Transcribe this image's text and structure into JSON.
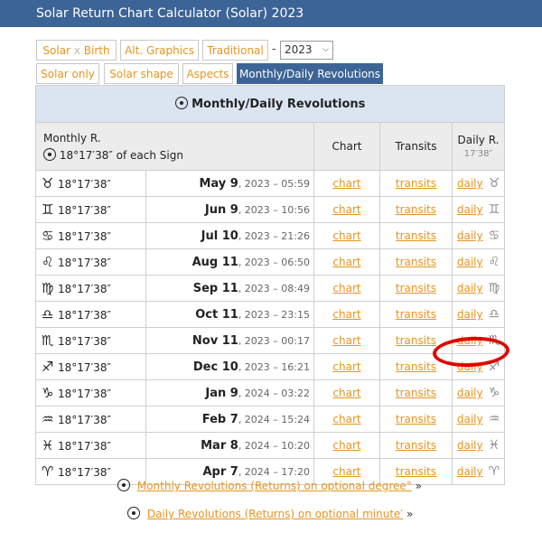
{
  "window": {
    "title": "Solar Return Chart Calculator (Solar) 2023"
  },
  "tabs_row1": [
    {
      "label": "Solar",
      "x": " x ",
      "label2": "Birth"
    },
    {
      "label": "Alt. Graphics"
    },
    {
      "label": "Traditional"
    }
  ],
  "year_select": {
    "separator": "-",
    "value": "2023"
  },
  "tabs_row2": [
    {
      "label": "Solar only"
    },
    {
      "label": "Solar shape"
    },
    {
      "label": "Aspects"
    },
    {
      "label": "Monthly/Daily Revolutions",
      "active": true
    }
  ],
  "table": {
    "caption": "Monthly/Daily Revolutions",
    "header": {
      "monthly_title": "Monthly R.",
      "monthly_sub": "18°17′38″ of each Sign",
      "chart": "Chart",
      "transits": "Transits",
      "daily_title": "Daily R.",
      "daily_sub": "17′38″"
    },
    "rows": [
      {
        "sign": "♉",
        "degree": "18°17′38″",
        "date": "May 9",
        "rest": ", 2023 – 05:59",
        "chart": "chart",
        "transits": "transits",
        "daily": "daily",
        "dsign": "♉"
      },
      {
        "sign": "♊",
        "degree": "18°17′38″",
        "date": "Jun 9",
        "rest": ", 2023 – 10:56",
        "chart": "chart",
        "transits": "transits",
        "daily": "daily",
        "dsign": "♊"
      },
      {
        "sign": "♋",
        "degree": "18°17′38″",
        "date": "Jul 10",
        "rest": ", 2023 – 21:26",
        "chart": "chart",
        "transits": "transits",
        "daily": "daily",
        "dsign": "♋"
      },
      {
        "sign": "♌",
        "degree": "18°17′38″",
        "date": "Aug 11",
        "rest": ", 2023 – 06:50",
        "chart": "chart",
        "transits": "transits",
        "daily": "daily",
        "dsign": "♌"
      },
      {
        "sign": "♍",
        "degree": "18°17′38″",
        "date": "Sep 11",
        "rest": ", 2023 – 08:49",
        "chart": "chart",
        "transits": "transits",
        "daily": "daily",
        "dsign": "♍"
      },
      {
        "sign": "♎",
        "degree": "18°17′38″",
        "date": "Oct 11",
        "rest": ", 2023 – 23:15",
        "chart": "chart",
        "transits": "transits",
        "daily": "daily",
        "dsign": "♎"
      },
      {
        "sign": "♏",
        "degree": "18°17′38″",
        "date": "Nov 11",
        "rest": ", 2023 – 00:17",
        "chart": "chart",
        "transits": "transits",
        "daily": "daily",
        "dsign": "♏"
      },
      {
        "sign": "♐",
        "degree": "18°17′38″",
        "date": "Dec 10",
        "rest": ", 2023 – 16:21",
        "chart": "chart",
        "transits": "transits",
        "daily": "daily",
        "dsign": "♐"
      },
      {
        "sign": "♑",
        "degree": "18°17′38″",
        "date": "Jan 9",
        "rest": ", 2024 – 03:22",
        "chart": "chart",
        "transits": "transits",
        "daily": "daily",
        "dsign": "♑"
      },
      {
        "sign": "♒",
        "degree": "18°17′38″",
        "date": "Feb 7",
        "rest": ", 2024 – 15:24",
        "chart": "chart",
        "transits": "transits",
        "daily": "daily",
        "dsign": "♒"
      },
      {
        "sign": "♓",
        "degree": "18°17′38″",
        "date": "Mar 8",
        "rest": ", 2024 – 10:20",
        "chart": "chart",
        "transits": "transits",
        "daily": "daily",
        "dsign": "♓"
      },
      {
        "sign": "♈",
        "degree": "18°17′38″",
        "date": "Apr 7",
        "rest": ", 2024 – 17:20",
        "chart": "chart",
        "transits": "transits",
        "daily": "daily",
        "dsign": "♈"
      }
    ]
  },
  "links": {
    "monthly": "Monthly Revolutions (Returns) on optional degree°",
    "daily": "Daily Revolutions (Returns) on optional minute′",
    "raquo": "»"
  },
  "colors": {
    "accent": "#e8941f",
    "titlebar": "#3c6496",
    "highlight": "#e00000"
  },
  "icons": [
    "sun-icon"
  ]
}
